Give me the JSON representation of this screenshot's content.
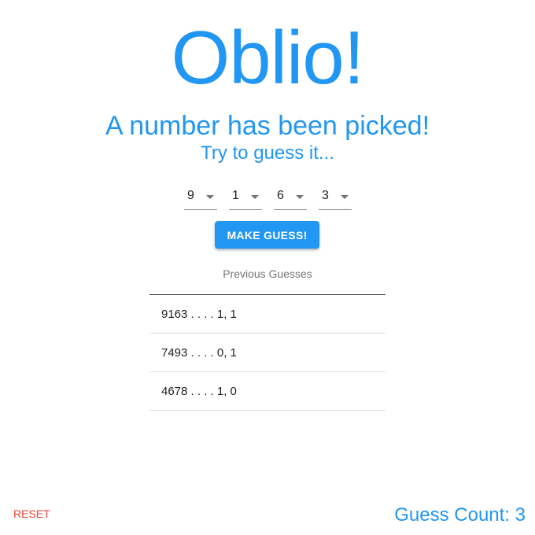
{
  "header": {
    "title": "Oblio!",
    "subtitle": "A number has been picked!",
    "hint": "Try to guess it..."
  },
  "digits": [
    {
      "value": "9"
    },
    {
      "value": "1"
    },
    {
      "value": "6"
    },
    {
      "value": "3"
    }
  ],
  "make_guess_label": "MAKE GUESS!",
  "previous": {
    "header": "Previous Guesses",
    "rows": [
      "9163 . . . . 1, 1",
      "7493 . . . . 0, 1",
      "4678 . . . . 1, 0"
    ]
  },
  "footer": {
    "reset_label": "RESET",
    "count_label": "Guess Count: 3"
  },
  "colors": {
    "primary": "#2196f3",
    "danger": "#f44336"
  }
}
